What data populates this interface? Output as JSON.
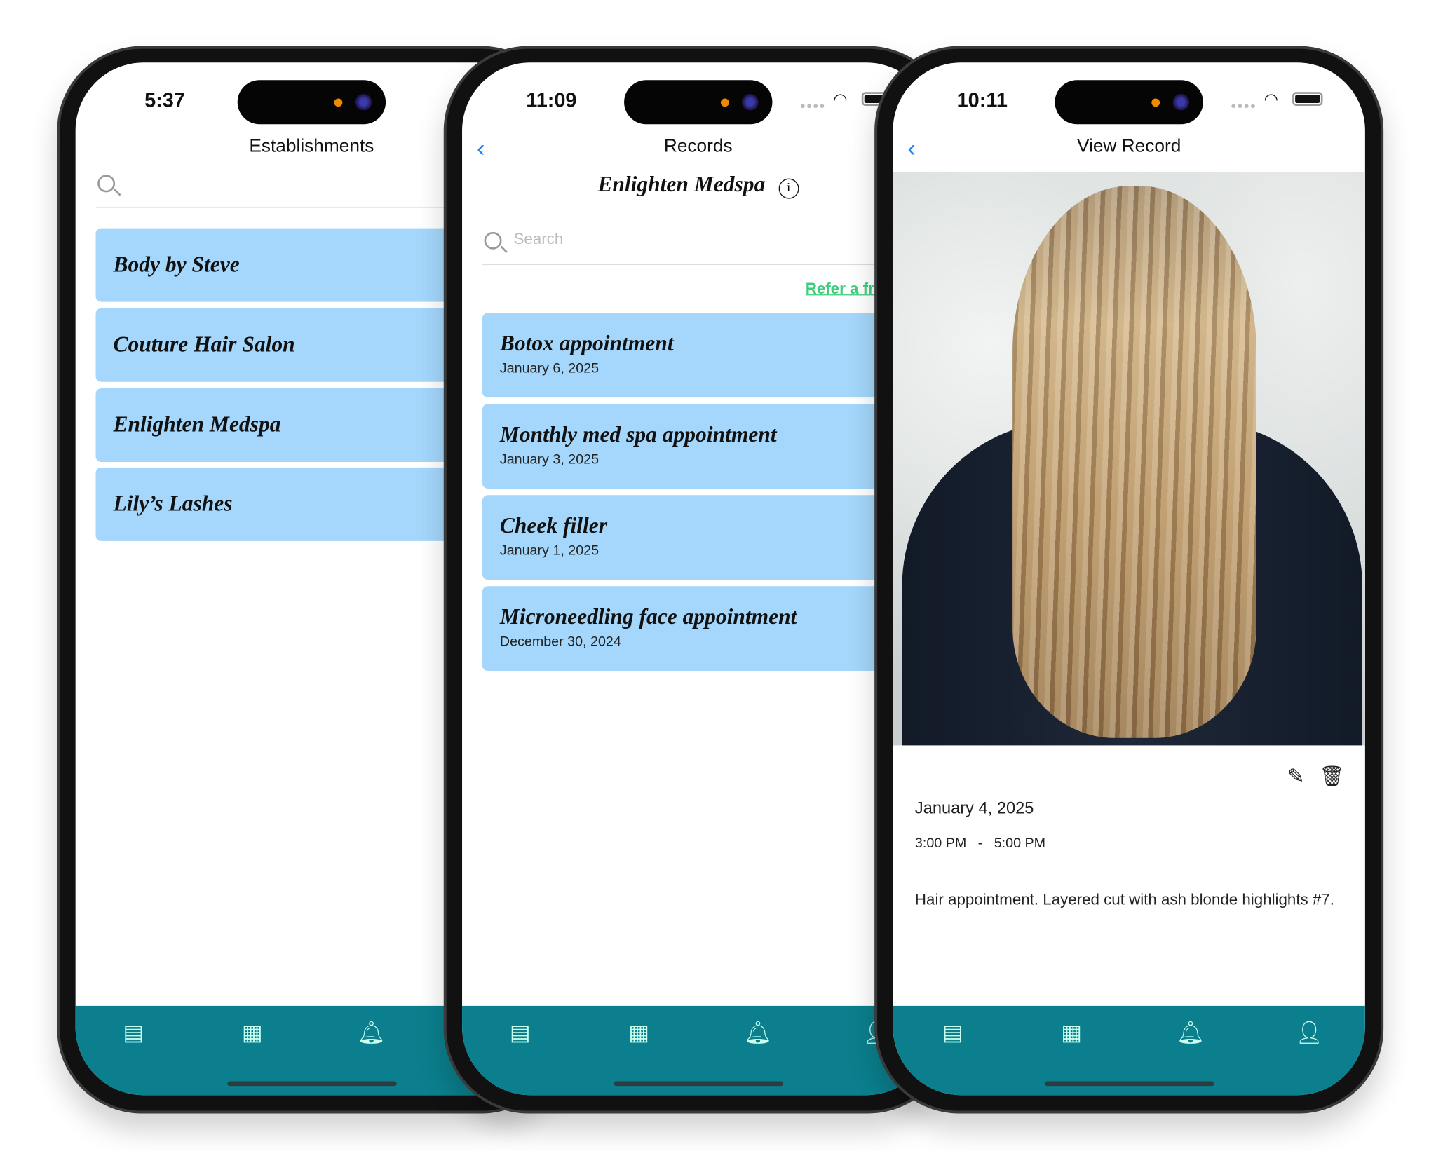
{
  "colors": {
    "card": "#a4d7fb",
    "tabbar": "#0b7f8d",
    "back": "#1a7ef5",
    "refer": "#3ecf7e"
  },
  "tabs": [
    {
      "icon": "document-icon",
      "glyph": "▤"
    },
    {
      "icon": "calendar-icon",
      "glyph": "▦"
    },
    {
      "icon": "bell-icon",
      "glyph": "🔔︎"
    },
    {
      "icon": "profile-icon",
      "glyph": "👤︎"
    }
  ],
  "phone1": {
    "time": "5:37",
    "title": "Establishments",
    "items": [
      "Body by Steve",
      "Couture Hair Salon",
      "Enlighten Medspa",
      "Lily’s Lashes"
    ]
  },
  "phone2": {
    "time": "11:09",
    "title": "Records",
    "establishment": "Enlighten Medspa",
    "search_placeholder": "Search",
    "refer": "Refer a friend",
    "records": [
      {
        "title": "Botox appointment",
        "date": "January 6, 2025"
      },
      {
        "title": "Monthly med spa appointment",
        "date": "January 3, 2025"
      },
      {
        "title": "Cheek filler",
        "date": "January 1, 2025"
      },
      {
        "title": "Microneedling face appointment",
        "date": "December 30, 2024"
      }
    ]
  },
  "phone3": {
    "time": "10:11",
    "title": "View Record",
    "date": "January 4, 2025",
    "start": "3:00 PM",
    "sep": "-",
    "end": "5:00 PM",
    "note": "Hair appointment. Layered cut with ash blonde highlights #7."
  }
}
